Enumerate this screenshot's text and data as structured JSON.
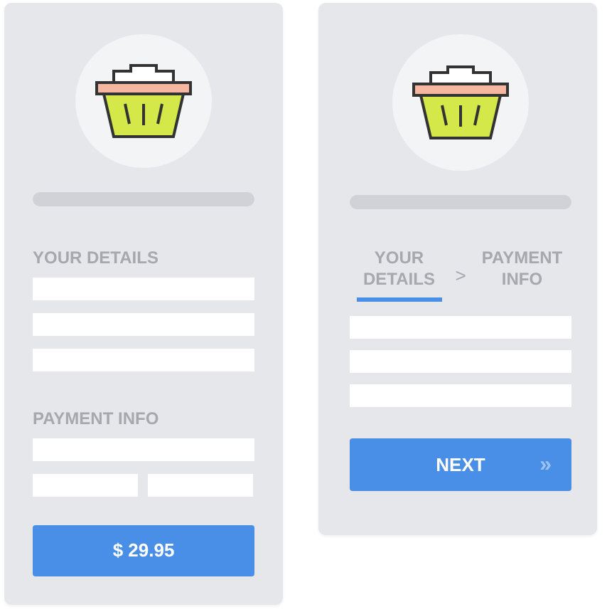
{
  "cards": [
    {
      "kind": "single",
      "sections": [
        {
          "label": "YOUR DETAILS",
          "fields": [
            {
              "kind": "full"
            },
            {
              "kind": "full"
            },
            {
              "kind": "full"
            }
          ]
        },
        {
          "label": "PAYMENT INFO",
          "fields": [
            {
              "kind": "full"
            },
            {
              "kind": "half"
            },
            {
              "kind": "half"
            }
          ]
        }
      ],
      "button": {
        "label": "$ 29.95"
      }
    },
    {
      "kind": "steps",
      "steps": [
        {
          "label": "YOUR DETAILS",
          "selected": true
        },
        {
          "label": "PAYMENT INFO",
          "selected": false
        }
      ],
      "separator": ">",
      "sections": [
        {
          "fields": [
            {
              "kind": "full"
            },
            {
              "kind": "full"
            },
            {
              "kind": "full"
            }
          ]
        }
      ],
      "button": {
        "label": "NEXT",
        "arrow": "»"
      }
    }
  ]
}
